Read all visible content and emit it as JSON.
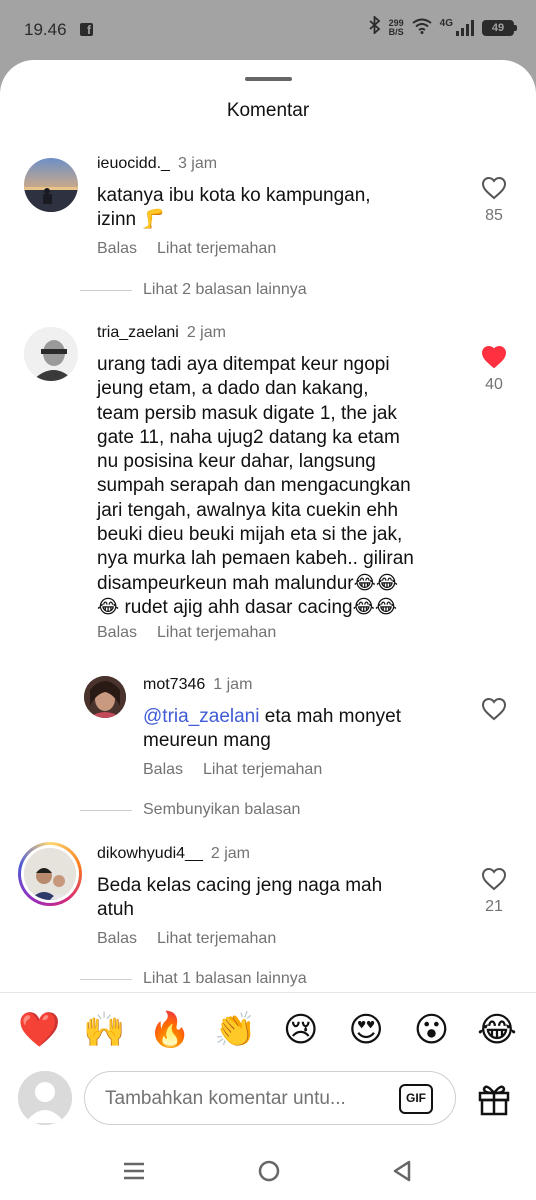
{
  "status": {
    "time": "19.46",
    "speed_value": "299",
    "speed_unit": "B/S",
    "network": "4G",
    "battery": "49"
  },
  "sheet": {
    "title": "Komentar"
  },
  "comments": [
    {
      "username": "ieuocidd._",
      "time": "3 jam",
      "text": "katanya ibu kota ko kampungan,\nizinn 🦵",
      "reply_label": "Balas",
      "translate_label": "Lihat terjemahan",
      "likes": "85",
      "liked": false,
      "thread_label": "Lihat 2 balasan lainnya"
    },
    {
      "username": "tria_zaelani",
      "time": "2 jam",
      "text": "urang tadi aya ditempat keur ngopi\njeung etam, a dado dan kakang,\nteam persib masuk digate 1, the jak\ngate 11, naha ujug2 datang ka etam\nnu posisina keur dahar, langsung\nsumpah serapah dan mengacungkan\njari tengah, awalnya kita cuekin ehh\nbeuki dieu beuki mijah eta si the jak,\nnya murka lah pemaen kabeh.. giliran\ndisampeurkeun mah malundur😂😂\n😂 rudet ajig ahh dasar cacing😂😂",
      "reply_label": "Balas",
      "translate_label": "Lihat terjemahan",
      "likes": "40",
      "liked": true,
      "like_color": "#ff3040"
    },
    {
      "username": "mot7346",
      "time": "1 jam",
      "mention": "@tria_zaelani",
      "text": " eta mah monyet\nmeureun mang",
      "reply_label": "Balas",
      "translate_label": "Lihat terjemahan",
      "liked": false,
      "thread_label": "Sembunyikan balasan"
    },
    {
      "username": "dikowhyudi4__",
      "time": "2 jam",
      "text": "Beda kelas cacing jeng naga mah\natuh",
      "reply_label": "Balas",
      "translate_label": "Lihat terjemahan",
      "likes": "21",
      "liked": false,
      "thread_label": "Lihat 1 balasan lainnya"
    }
  ],
  "reactions": [
    "❤️",
    "🙌",
    "🔥",
    "👏",
    "😢",
    "😍",
    "😮",
    "😂"
  ],
  "composer": {
    "placeholder": "Tambahkan komentar untu...",
    "gif_label": "GIF"
  }
}
